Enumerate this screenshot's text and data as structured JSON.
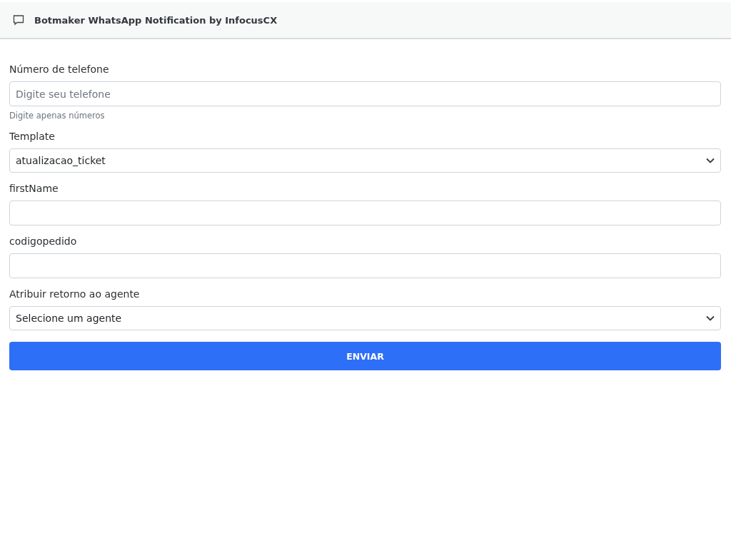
{
  "header": {
    "title": "Botmaker WhatsApp Notification by InfocusCX"
  },
  "fields": [
    {
      "kind": "text",
      "label": "Número de telefone",
      "placeholder": "Digite seu telefone",
      "help": "Digite apenas números"
    },
    {
      "kind": "select",
      "label": "Template",
      "value": "atualizacao_ticket"
    },
    {
      "kind": "text",
      "label": "firstName"
    },
    {
      "kind": "text",
      "label": "codigopedido"
    },
    {
      "kind": "select",
      "label": "Atribuir retorno ao agente",
      "value": "Selecione um agente"
    }
  ],
  "submit": {
    "label": "ENVIAR"
  }
}
